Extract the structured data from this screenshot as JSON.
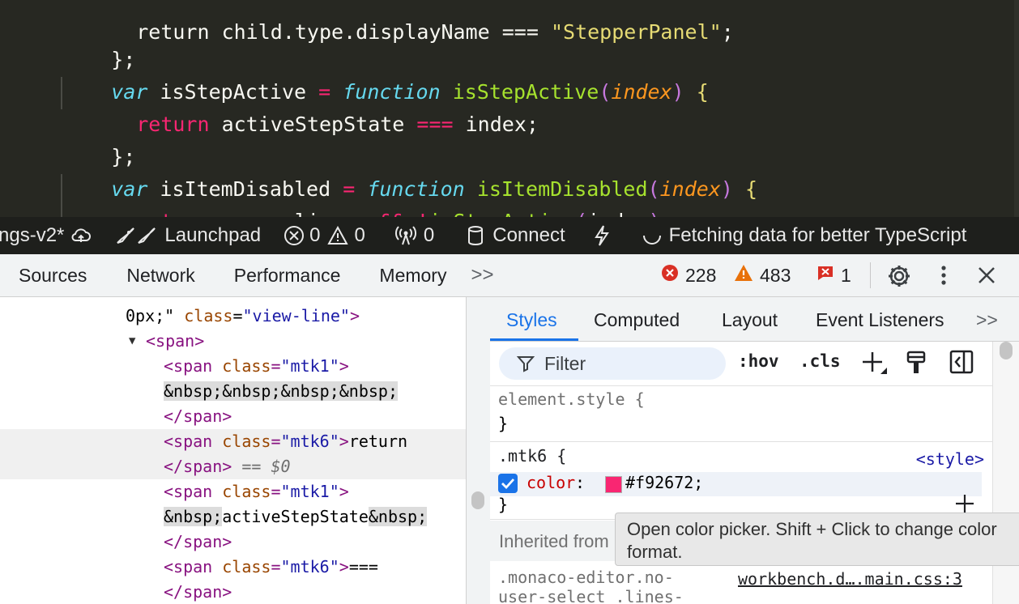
{
  "editor": {
    "line0": {
      "t1": "return child.type.displayName === ",
      "t2": "\"StepperPanel\"",
      "t3": ";"
    },
    "line1": {
      "close": "};"
    },
    "line2": {
      "var": "var",
      "name": " isStepActive ",
      "eq": "=",
      "fn": "function",
      "fname": "isStepActive",
      "lp": "(",
      "param": "index",
      "rp": ")",
      "lb": "{"
    },
    "line3": {
      "ret": "return",
      "body1": " activeStepState ",
      "op": "===",
      "body2": " index;"
    },
    "line4": {
      "close": "};"
    },
    "line5": {
      "var": "var",
      "name": " isItemDisabled ",
      "eq": "=",
      "fn": "function",
      "fname": "isItemDisabled",
      "lp": "(",
      "param": "index",
      "rp": ")",
      "lb": "{"
    },
    "line6": {
      "ret": "return",
      "body1": " props.linear ",
      "op1": "&&",
      "op2": "!",
      "call": "isStepActive",
      "lp": "(",
      "arg": "index",
      "rp": ")",
      "end": ";"
    }
  },
  "statusbar": {
    "branch": "ngs-v2*",
    "launchpad": "Launchpad",
    "errors": "0",
    "warnings": "0",
    "ports": "0",
    "connect": "Connect",
    "fetching": "Fetching data for better TypeScript"
  },
  "devtools": {
    "tabs": [
      "Sources",
      "Network",
      "Performance",
      "Memory"
    ],
    "more_tabs": ">>",
    "error_count": "228",
    "warning_count": "483",
    "issue_count": "1"
  },
  "elements": {
    "l0": {
      "a": "0px;\" ",
      "attr": "class",
      "eq": "=",
      "val": "\"view-line\"",
      "b": ">"
    },
    "l1": {
      "tag": "<span>"
    },
    "l2": {
      "open": "<span ",
      "attr": "class",
      "eq": "=",
      "val": "\"mtk1\"",
      "close": ">"
    },
    "l3": {
      "n1": "&nbsp;",
      "n2": "&nbsp;",
      "n3": "&nbsp;",
      "n4": "&nbsp;"
    },
    "l4": {
      "tag": "</span>"
    },
    "l5": {
      "open": "<span ",
      "attr": "class",
      "eq": "=",
      "val": "\"mtk6\"",
      "close": ">",
      "text": "return"
    },
    "l6": {
      "tag": "</span>",
      "marker": " == ",
      "dollar": "$0"
    },
    "l7": {
      "open": "<span ",
      "attr": "class",
      "eq": "=",
      "val": "\"mtk1\"",
      "close": ">"
    },
    "l8": {
      "n1": "&nbsp;",
      "text": "activeStepState",
      "n2": "&nbsp;"
    },
    "l9": {
      "tag": "</span>"
    },
    "l10": {
      "open": "<span ",
      "attr": "class",
      "eq": "=",
      "val": "\"mtk6\"",
      "close": ">",
      "text": "==="
    },
    "l11": {
      "tag": "</span>"
    }
  },
  "styles": {
    "tabs": [
      "Styles",
      "Computed",
      "Layout",
      "Event Listeners"
    ],
    "more_tabs": ">>",
    "filter_placeholder": "Filter",
    "hov": ":hov",
    "cls": ".cls",
    "element_style": "element.style {",
    "close_brace": "}",
    "mtk6_selector": ".mtk6 {",
    "mtk6_source": "<style>",
    "prop": "color",
    "colon": ":",
    "value": "#f92672;",
    "swatch_color": "#f92672",
    "inherited": "Inherited from",
    "monaco_line1": ".monaco-editor.no-",
    "monaco_line2": "user-select .lines-",
    "monaco_source": "workbench.d….main.css:3",
    "tooltip_line1": "Open color picker. Shift + Click to change color",
    "tooltip_line2": "format."
  },
  "colors": {
    "editor_bg": "#272822",
    "statusbar_bg": "#1e1f1c",
    "accent_blue": "#1a73e8",
    "error_red": "#d93025",
    "warning_orange": "#e8710a"
  }
}
